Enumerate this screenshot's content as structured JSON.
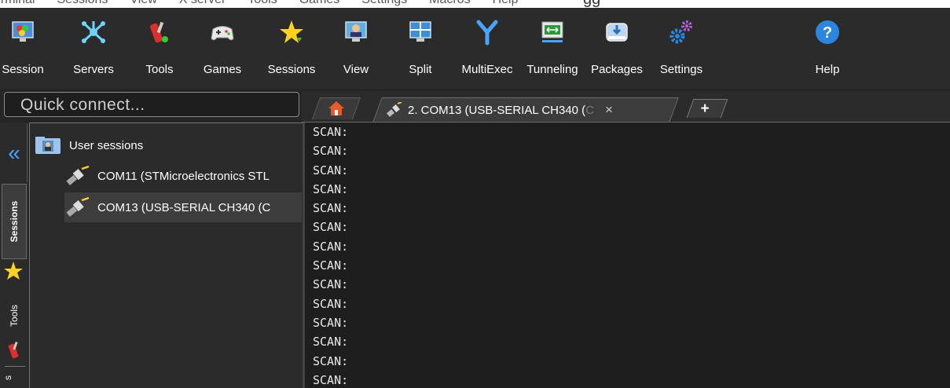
{
  "menu": [
    "erminal",
    "Sessions",
    "View",
    "X server",
    "Tools",
    "Games",
    "Settings",
    "Macros",
    "Help"
  ],
  "window_title_fragment": "gg",
  "toolbar": [
    {
      "label": "Session",
      "icon": "session-icon"
    },
    {
      "label": "Servers",
      "icon": "servers-icon"
    },
    {
      "label": "Tools",
      "icon": "tools-icon"
    },
    {
      "label": "Games",
      "icon": "gamepad-icon"
    },
    {
      "label": "Sessions",
      "icon": "star-icon"
    },
    {
      "label": "View",
      "icon": "view-icon"
    },
    {
      "label": "Split",
      "icon": "split-icon"
    },
    {
      "label": "MultiExec",
      "icon": "multiexec-icon"
    },
    {
      "label": "Tunneling",
      "icon": "tunneling-icon"
    },
    {
      "label": "Packages",
      "icon": "packages-icon"
    },
    {
      "label": "Settings",
      "icon": "gears-icon"
    },
    {
      "label": "Help",
      "icon": "help-icon"
    }
  ],
  "quick_connect": {
    "placeholder": "Quick connect..."
  },
  "tabs": {
    "active_label": "2. COM13  (USB-SERIAL CH340 (C",
    "active_label_fade": "C",
    "close": "×",
    "new": "+"
  },
  "side_tabs": {
    "sessions": "Sessions",
    "tools": "Tools",
    "macros": "s"
  },
  "tree": {
    "root": "User sessions",
    "items": [
      {
        "label": "COM11  (STMicroelectronics STL"
      },
      {
        "label": "COM13  (USB-SERIAL CH340 (C"
      }
    ]
  },
  "terminal": {
    "lines": [
      "SCAN:",
      "SCAN:",
      "SCAN:",
      "SCAN:",
      "SCAN:",
      "SCAN:",
      "SCAN:",
      "SCAN:",
      "SCAN:",
      "SCAN:",
      "SCAN:",
      "SCAN:",
      "SCAN:",
      "SCAN:"
    ]
  },
  "colors": {
    "accent_blue": "#4aa3ff",
    "background": "#252525"
  }
}
